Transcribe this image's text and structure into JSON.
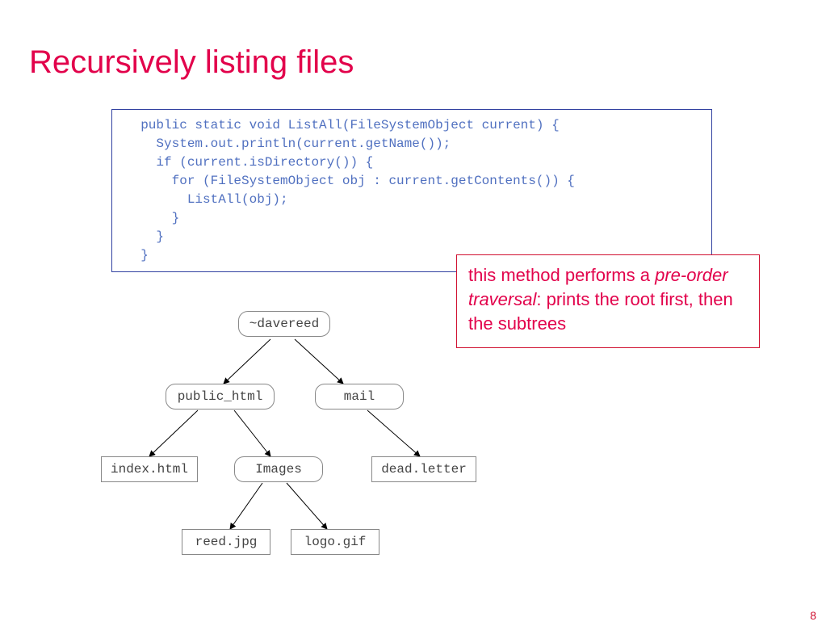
{
  "title": "Recursively listing files",
  "code": "  public static void ListAll(FileSystemObject current) {\n    System.out.println(current.getName());\n    if (current.isDirectory()) {\n      for (FileSystemObject obj : current.getContents()) {\n        ListAll(obj);\n      }\n    }\n  }",
  "callout": {
    "prefix": "this method performs a ",
    "italic": "pre-order traversal",
    "suffix": ": prints the root first, then the subtrees"
  },
  "tree": {
    "davereed": "~davereed",
    "public_html": "public_html",
    "mail": "mail",
    "index_html": "index.html",
    "images": "Images",
    "dead_letter": "dead.letter",
    "reed_jpg": "reed.jpg",
    "logo_gif": "logo.gif"
  },
  "page_number": "8"
}
